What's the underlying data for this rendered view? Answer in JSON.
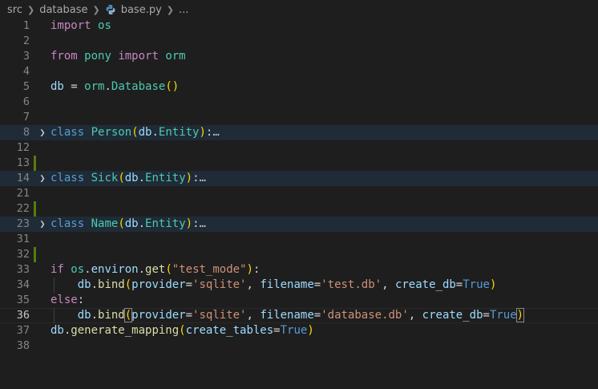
{
  "breadcrumb": {
    "items": [
      "src",
      "database",
      "base.py",
      "..."
    ]
  },
  "editor": {
    "lines": [
      {
        "num": "1",
        "code": [
          [
            "kw",
            "import"
          ],
          [
            "op",
            " "
          ],
          [
            "cls",
            "os"
          ]
        ]
      },
      {
        "num": "2",
        "code": []
      },
      {
        "num": "3",
        "code": [
          [
            "kw",
            "from"
          ],
          [
            "op",
            " "
          ],
          [
            "cls",
            "pony"
          ],
          [
            "op",
            " "
          ],
          [
            "kw",
            "import"
          ],
          [
            "op",
            " "
          ],
          [
            "cls",
            "orm"
          ]
        ]
      },
      {
        "num": "4",
        "code": []
      },
      {
        "num": "5",
        "code": [
          [
            "var",
            "db"
          ],
          [
            "op",
            " = "
          ],
          [
            "cls",
            "orm"
          ],
          [
            "op",
            "."
          ],
          [
            "cls",
            "Database"
          ],
          [
            "paren",
            "()"
          ]
        ]
      },
      {
        "num": "6",
        "code": []
      },
      {
        "num": "7",
        "code": []
      },
      {
        "num": "8",
        "folded": true,
        "fold": true,
        "code": [
          [
            "kw2",
            "class"
          ],
          [
            "op",
            " "
          ],
          [
            "cls",
            "Person"
          ],
          [
            "paren",
            "("
          ],
          [
            "var",
            "db"
          ],
          [
            "op",
            "."
          ],
          [
            "cls",
            "Entity"
          ],
          [
            "paren",
            ")"
          ],
          [
            "op",
            ":"
          ],
          [
            "ell",
            "…"
          ]
        ]
      },
      {
        "num": "12",
        "code": []
      },
      {
        "num": "13",
        "bar": true,
        "code": []
      },
      {
        "num": "14",
        "folded": true,
        "fold": true,
        "code": [
          [
            "kw2",
            "class"
          ],
          [
            "op",
            " "
          ],
          [
            "cls",
            "Sick"
          ],
          [
            "paren",
            "("
          ],
          [
            "var",
            "db"
          ],
          [
            "op",
            "."
          ],
          [
            "cls",
            "Entity"
          ],
          [
            "paren",
            ")"
          ],
          [
            "op",
            ":"
          ],
          [
            "ell",
            "…"
          ]
        ]
      },
      {
        "num": "21",
        "code": []
      },
      {
        "num": "22",
        "bar": true,
        "code": []
      },
      {
        "num": "23",
        "folded": true,
        "fold": true,
        "code": [
          [
            "kw2",
            "class"
          ],
          [
            "op",
            " "
          ],
          [
            "cls",
            "Name"
          ],
          [
            "paren",
            "("
          ],
          [
            "var",
            "db"
          ],
          [
            "op",
            "."
          ],
          [
            "cls",
            "Entity"
          ],
          [
            "paren",
            ")"
          ],
          [
            "op",
            ":"
          ],
          [
            "ell",
            "…"
          ]
        ]
      },
      {
        "num": "31",
        "code": []
      },
      {
        "num": "32",
        "bar": true,
        "code": []
      },
      {
        "num": "33",
        "code": [
          [
            "kw",
            "if"
          ],
          [
            "op",
            " "
          ],
          [
            "cls",
            "os"
          ],
          [
            "op",
            "."
          ],
          [
            "var",
            "environ"
          ],
          [
            "op",
            "."
          ],
          [
            "fn",
            "get"
          ],
          [
            "paren",
            "("
          ],
          [
            "str",
            "\"test_mode\""
          ],
          [
            "paren",
            ")"
          ],
          [
            "op",
            ":"
          ]
        ]
      },
      {
        "num": "34",
        "indent": true,
        "code": [
          [
            "op",
            "    "
          ],
          [
            "var",
            "db"
          ],
          [
            "op",
            "."
          ],
          [
            "fn",
            "bind"
          ],
          [
            "paren",
            "("
          ],
          [
            "var",
            "provider"
          ],
          [
            "op",
            "="
          ],
          [
            "str",
            "'sqlite'"
          ],
          [
            "op",
            ", "
          ],
          [
            "var",
            "filename"
          ],
          [
            "op",
            "="
          ],
          [
            "str",
            "'test.db'"
          ],
          [
            "op",
            ", "
          ],
          [
            "var",
            "create_db"
          ],
          [
            "op",
            "="
          ],
          [
            "kw2",
            "True"
          ],
          [
            "paren",
            ")"
          ]
        ]
      },
      {
        "num": "35",
        "code": [
          [
            "kw",
            "else"
          ],
          [
            "op",
            ":"
          ]
        ]
      },
      {
        "num": "36",
        "indent": true,
        "current": true,
        "code": [
          [
            "op",
            "    "
          ],
          [
            "var",
            "db"
          ],
          [
            "op",
            "."
          ],
          [
            "fn",
            "bind"
          ],
          [
            "paren",
            "("
          ],
          [
            "var",
            "provider"
          ],
          [
            "op",
            "="
          ],
          [
            "str",
            "'sqlite'"
          ],
          [
            "op",
            ", "
          ],
          [
            "var",
            "filename"
          ],
          [
            "op",
            "="
          ],
          [
            "str",
            "'database.db'"
          ],
          [
            "op",
            ", "
          ],
          [
            "var",
            "create_db"
          ],
          [
            "op",
            "="
          ],
          [
            "kw2",
            "True"
          ],
          [
            "paren",
            ")"
          ]
        ]
      },
      {
        "num": "37",
        "code": [
          [
            "var",
            "db"
          ],
          [
            "op",
            "."
          ],
          [
            "fn",
            "generate_mapping"
          ],
          [
            "paren",
            "("
          ],
          [
            "var",
            "create_tables"
          ],
          [
            "op",
            "="
          ],
          [
            "kw2",
            "True"
          ],
          [
            "paren",
            ")"
          ]
        ]
      },
      {
        "num": "38",
        "code": []
      }
    ]
  },
  "icons": {
    "breadcrumb_separator": "chevron-right-icon",
    "file_icon": "python-icon",
    "fold": "chevron-right-icon"
  },
  "colors": {
    "background": "#1e1e1e",
    "keyword": "#c586c0",
    "class": "#4ec9b0",
    "string": "#ce9178",
    "variable": "#9cdcfe",
    "function": "#dcdcaa",
    "gutter_added": "#587c0c"
  }
}
